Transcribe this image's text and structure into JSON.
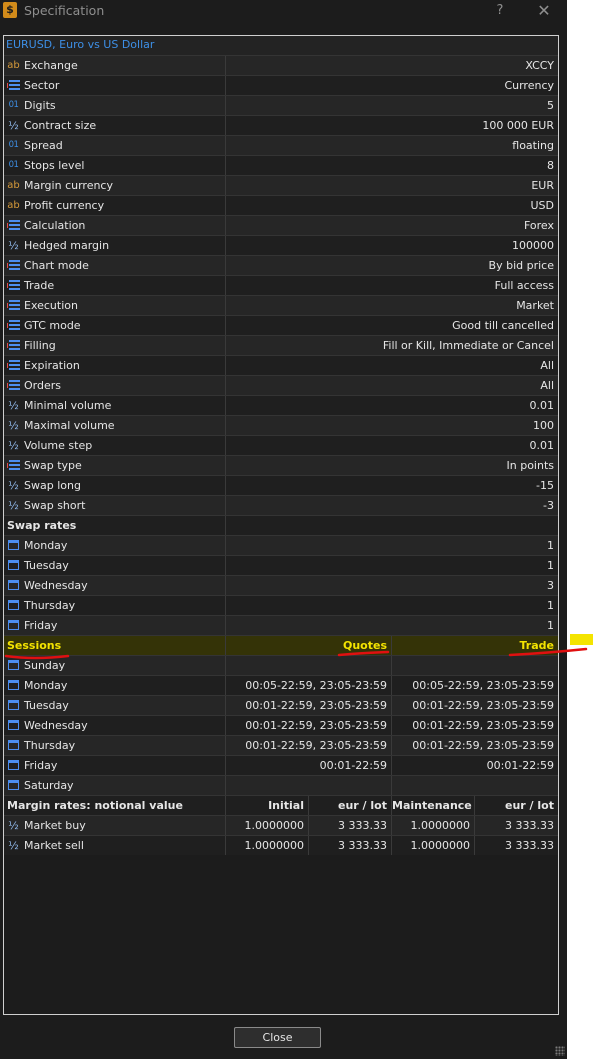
{
  "window": {
    "title": "Specification",
    "help_glyph": "?",
    "close_glyph": "✕",
    "close_button": "Close"
  },
  "symbol_title": "EURUSD, Euro vs US Dollar",
  "properties": [
    {
      "icon": "text-type-icon",
      "name": "Exchange",
      "value": "XCCY"
    },
    {
      "icon": "list-type-icon",
      "name": "Sector",
      "value": "Currency"
    },
    {
      "icon": "integer-type-icon",
      "name": "Digits",
      "value": "5"
    },
    {
      "icon": "fraction-type-icon",
      "name": "Contract size",
      "value": "100 000 EUR"
    },
    {
      "icon": "integer-type-icon",
      "name": "Spread",
      "value": "floating"
    },
    {
      "icon": "integer-type-icon",
      "name": "Stops level",
      "value": "8"
    },
    {
      "icon": "text-type-icon",
      "name": "Margin currency",
      "value": "EUR"
    },
    {
      "icon": "text-type-icon",
      "name": "Profit currency",
      "value": "USD"
    },
    {
      "icon": "list-type-icon",
      "name": "Calculation",
      "value": "Forex"
    },
    {
      "icon": "fraction-type-icon",
      "name": "Hedged margin",
      "value": "100000"
    },
    {
      "icon": "list-type-icon",
      "name": "Chart mode",
      "value": "By bid price"
    },
    {
      "icon": "list-type-icon",
      "name": "Trade",
      "value": "Full access"
    },
    {
      "icon": "list-type-icon",
      "name": "Execution",
      "value": "Market"
    },
    {
      "icon": "list-type-icon",
      "name": "GTC mode",
      "value": "Good till cancelled"
    },
    {
      "icon": "list-type-icon",
      "name": "Filling",
      "value": "Fill or Kill, Immediate or Cancel"
    },
    {
      "icon": "list-type-icon",
      "name": "Expiration",
      "value": "All"
    },
    {
      "icon": "list-type-icon",
      "name": "Orders",
      "value": "All"
    },
    {
      "icon": "fraction-type-icon",
      "name": "Minimal volume",
      "value": "0.01"
    },
    {
      "icon": "fraction-type-icon",
      "name": "Maximal volume",
      "value": "100"
    },
    {
      "icon": "fraction-type-icon",
      "name": "Volume step",
      "value": "0.01"
    },
    {
      "icon": "list-type-icon",
      "name": "Swap type",
      "value": "In points"
    },
    {
      "icon": "fraction-type-icon",
      "name": "Swap long",
      "value": "-15"
    },
    {
      "icon": "fraction-type-icon",
      "name": "Swap short",
      "value": "-3"
    }
  ],
  "swap_rates": {
    "header": "Swap rates",
    "rows": [
      {
        "day": "Monday",
        "value": "1"
      },
      {
        "day": "Tuesday",
        "value": "1"
      },
      {
        "day": "Wednesday",
        "value": "3"
      },
      {
        "day": "Thursday",
        "value": "1"
      },
      {
        "day": "Friday",
        "value": "1"
      }
    ]
  },
  "sessions": {
    "header": "Sessions",
    "col_quotes": "Quotes",
    "col_trade": "Trade",
    "highlight_color": "#f4e400",
    "annotation_color": "#e01010",
    "rows": [
      {
        "day": "Sunday",
        "quotes": "",
        "trade": ""
      },
      {
        "day": "Monday",
        "quotes": "00:05-22:59, 23:05-23:59",
        "trade": "00:05-22:59, 23:05-23:59"
      },
      {
        "day": "Tuesday",
        "quotes": "00:01-22:59, 23:05-23:59",
        "trade": "00:01-22:59, 23:05-23:59"
      },
      {
        "day": "Wednesday",
        "quotes": "00:01-22:59, 23:05-23:59",
        "trade": "00:01-22:59, 23:05-23:59"
      },
      {
        "day": "Thursday",
        "quotes": "00:01-22:59, 23:05-23:59",
        "trade": "00:01-22:59, 23:05-23:59"
      },
      {
        "day": "Friday",
        "quotes": "00:01-22:59",
        "trade": "00:01-22:59"
      },
      {
        "day": "Saturday",
        "quotes": "",
        "trade": ""
      }
    ]
  },
  "margin": {
    "header": "Margin rates: notional value",
    "col_initial": "Initial",
    "col_initial_unit": "eur / lot",
    "col_maintenance": "Maintenance",
    "col_maintenance_unit": "eur / lot",
    "rows": [
      {
        "name": "Market buy",
        "initial": "1.0000000",
        "initial_value": "3 333.33",
        "maintenance": "1.0000000",
        "maintenance_value": "3 333.33"
      },
      {
        "name": "Market sell",
        "initial": "1.0000000",
        "initial_value": "3 333.33",
        "maintenance": "1.0000000",
        "maintenance_value": "3 333.33"
      }
    ]
  }
}
